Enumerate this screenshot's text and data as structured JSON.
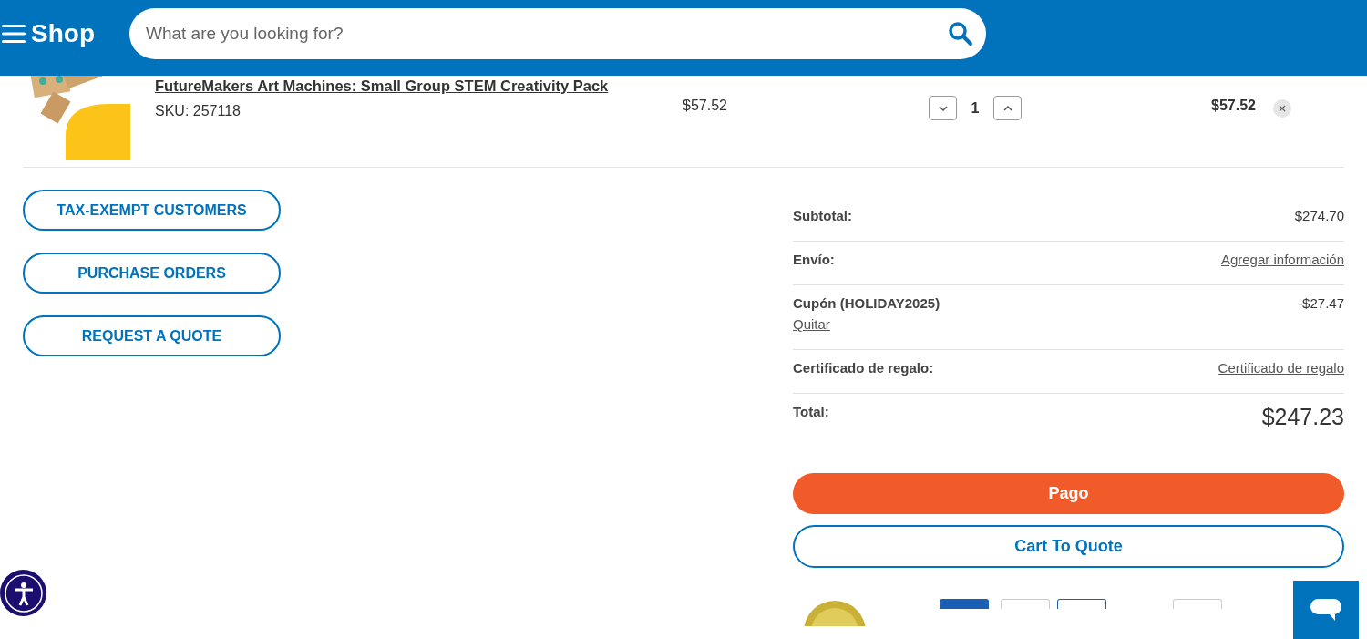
{
  "header": {
    "menu_label": "Shop",
    "search": {
      "placeholder": "What are you looking for?"
    }
  },
  "cart_item": {
    "title": "FutureMakers Art Machines: Small Group STEM Creativity Pack",
    "sku": "SKU: 257118",
    "price": "$57.52",
    "quantity": "1",
    "line_total": "$57.52"
  },
  "actions": [
    "TAX-EXEMPT CUSTOMERS",
    "PURCHASE ORDERS",
    "REQUEST A QUOTE"
  ],
  "summary": [
    {
      "kind": "value",
      "label": "Subtotal:",
      "value": "$274.70"
    },
    {
      "kind": "link",
      "label": "Envío:",
      "value": "Agregar información"
    },
    {
      "kind": "coupon",
      "label": "Cupón (HOLIDAY2025)",
      "link": "Quitar",
      "value": "-$27.47"
    },
    {
      "kind": "link",
      "label": "Certificado de regalo:",
      "value": "Certificado de regalo"
    },
    {
      "kind": "total",
      "label": "Total:",
      "value": "$247.23"
    }
  ],
  "checkout_button": "Pago",
  "quote_button": "Cart To Quote"
}
